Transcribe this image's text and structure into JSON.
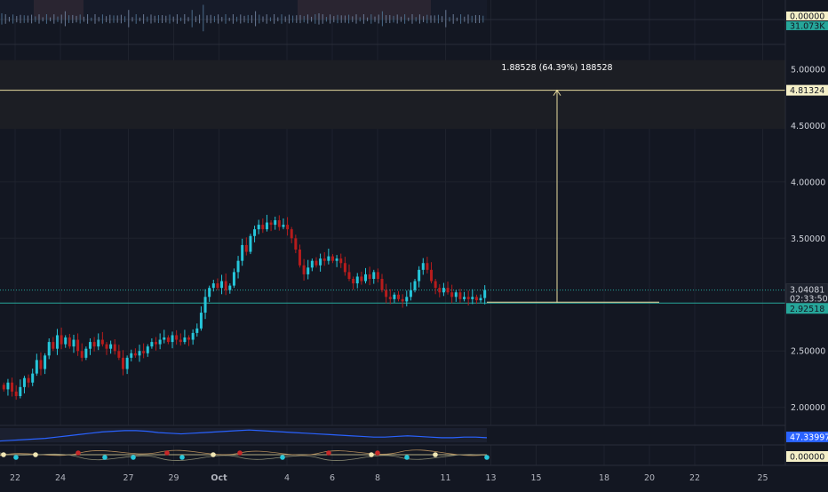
{
  "chart_data": {
    "type": "candlestick",
    "title": "",
    "colors": {
      "background": "#131722",
      "up": "#26c6da",
      "down": "#b71c1c",
      "grid": "#1e222d",
      "measure_zone": "#1c1e24",
      "measure_line": "#e8dca0",
      "price_line": "#26a69a",
      "oscillator_line": "#2962ff",
      "axis_text": "#d1d4dc"
    },
    "price_axis": {
      "ylim": [
        1.84,
        5.22
      ],
      "ticks": [
        {
          "value": 5.0,
          "label": "5.00000"
        },
        {
          "value": 4.5,
          "label": "4.50000"
        },
        {
          "value": 4.0,
          "label": "4.00000"
        },
        {
          "value": 3.5,
          "label": "3.50000"
        },
        {
          "value": 2.5,
          "label": "2.50000"
        },
        {
          "value": 2.0,
          "label": "2.00000"
        }
      ]
    },
    "time_axis": {
      "ticks": [
        {
          "pos": 4,
          "label": "22"
        },
        {
          "pos": 16,
          "label": "24"
        },
        {
          "pos": 34,
          "label": "27"
        },
        {
          "pos": 46,
          "label": "29"
        },
        {
          "pos": 58,
          "label": "Oct"
        },
        {
          "pos": 76,
          "label": "4"
        },
        {
          "pos": 88,
          "label": "6"
        },
        {
          "pos": 100,
          "label": "8"
        },
        {
          "pos": 118,
          "label": "11"
        },
        {
          "pos": 130,
          "label": "13"
        },
        {
          "pos": 142,
          "label": "15"
        },
        {
          "pos": 160,
          "label": "18"
        },
        {
          "pos": 172,
          "label": "20"
        },
        {
          "pos": 184,
          "label": "22"
        },
        {
          "pos": 202,
          "label": "25"
        }
      ],
      "xlim": [
        0,
        208
      ]
    },
    "candles": [
      [
        2.2,
        2.16
      ],
      [
        2.16,
        2.22
      ],
      [
        2.22,
        2.14
      ],
      [
        2.14,
        2.1
      ],
      [
        2.1,
        2.18
      ],
      [
        2.18,
        2.26
      ],
      [
        2.26,
        2.22
      ],
      [
        2.22,
        2.3
      ],
      [
        2.3,
        2.42
      ],
      [
        2.42,
        2.34
      ],
      [
        2.34,
        2.46
      ],
      [
        2.46,
        2.58
      ],
      [
        2.58,
        2.52
      ],
      [
        2.52,
        2.64
      ],
      [
        2.64,
        2.56
      ],
      [
        2.56,
        2.62
      ],
      [
        2.62,
        2.54
      ],
      [
        2.54,
        2.6
      ],
      [
        2.6,
        2.5
      ],
      [
        2.5,
        2.44
      ],
      [
        2.44,
        2.52
      ],
      [
        2.52,
        2.58
      ],
      [
        2.58,
        2.54
      ],
      [
        2.54,
        2.6
      ],
      [
        2.6,
        2.56
      ],
      [
        2.56,
        2.52
      ],
      [
        2.52,
        2.56
      ],
      [
        2.56,
        2.5
      ],
      [
        2.5,
        2.44
      ],
      [
        2.44,
        2.34
      ],
      [
        2.34,
        2.44
      ],
      [
        2.44,
        2.48
      ],
      [
        2.48,
        2.46
      ],
      [
        2.46,
        2.5
      ],
      [
        2.5,
        2.48
      ],
      [
        2.48,
        2.54
      ],
      [
        2.54,
        2.58
      ],
      [
        2.58,
        2.56
      ],
      [
        2.56,
        2.6
      ],
      [
        2.6,
        2.62
      ],
      [
        2.62,
        2.58
      ],
      [
        2.58,
        2.64
      ],
      [
        2.64,
        2.6
      ],
      [
        2.6,
        2.58
      ],
      [
        2.58,
        2.62
      ],
      [
        2.62,
        2.6
      ],
      [
        2.6,
        2.66
      ],
      [
        2.66,
        2.7
      ],
      [
        2.7,
        2.84
      ],
      [
        2.84,
        2.98
      ],
      [
        2.98,
        3.06
      ],
      [
        3.06,
        3.1
      ],
      [
        3.1,
        3.06
      ],
      [
        3.06,
        3.12
      ],
      [
        3.12,
        3.04
      ],
      [
        3.04,
        3.08
      ],
      [
        3.08,
        3.2
      ],
      [
        3.2,
        3.3
      ],
      [
        3.3,
        3.44
      ],
      [
        3.44,
        3.38
      ],
      [
        3.38,
        3.52
      ],
      [
        3.52,
        3.58
      ],
      [
        3.58,
        3.62
      ],
      [
        3.62,
        3.58
      ],
      [
        3.58,
        3.64
      ],
      [
        3.64,
        3.62
      ],
      [
        3.62,
        3.66
      ],
      [
        3.66,
        3.6
      ],
      [
        3.6,
        3.62
      ],
      [
        3.62,
        3.58
      ],
      [
        3.58,
        3.5
      ],
      [
        3.5,
        3.4
      ],
      [
        3.4,
        3.26
      ],
      [
        3.26,
        3.18
      ],
      [
        3.18,
        3.24
      ],
      [
        3.24,
        3.3
      ],
      [
        3.3,
        3.26
      ],
      [
        3.26,
        3.32
      ],
      [
        3.32,
        3.3
      ],
      [
        3.3,
        3.34
      ],
      [
        3.34,
        3.3
      ],
      [
        3.3,
        3.32
      ],
      [
        3.32,
        3.28
      ],
      [
        3.28,
        3.2
      ],
      [
        3.2,
        3.14
      ],
      [
        3.14,
        3.1
      ],
      [
        3.1,
        3.16
      ],
      [
        3.16,
        3.12
      ],
      [
        3.12,
        3.18
      ],
      [
        3.18,
        3.14
      ],
      [
        3.14,
        3.2
      ],
      [
        3.2,
        3.14
      ],
      [
        3.14,
        3.04
      ],
      [
        3.04,
        2.98
      ],
      [
        2.98,
        2.96
      ],
      [
        2.96,
        3.0
      ],
      [
        3.0,
        2.96
      ],
      [
        2.96,
        2.94
      ],
      [
        2.94,
        2.98
      ],
      [
        2.98,
        3.04
      ],
      [
        3.04,
        3.12
      ],
      [
        3.12,
        3.22
      ],
      [
        3.22,
        3.28
      ],
      [
        3.28,
        3.22
      ],
      [
        3.22,
        3.12
      ],
      [
        3.12,
        3.06
      ],
      [
        3.06,
        3.02
      ],
      [
        3.02,
        3.06
      ],
      [
        3.06,
        3.02
      ],
      [
        3.02,
        2.98
      ],
      [
        2.98,
        3.02
      ],
      [
        3.02,
        2.96
      ],
      [
        2.96,
        2.98
      ],
      [
        2.98,
        2.96
      ],
      [
        2.96,
        2.98
      ],
      [
        2.98,
        2.95
      ],
      [
        2.95,
        2.97
      ],
      [
        2.97,
        3.04
      ]
    ],
    "last_price": {
      "value": 3.04081,
      "label": "3.04081",
      "countdown": "02:33:50"
    },
    "support_line": {
      "value": 2.92518,
      "label": "2.92518"
    },
    "measure": {
      "from": 2.92518,
      "to": 4.81324,
      "zone_top": 5.08,
      "zone_bottom": 4.47,
      "label": "1.88528 (64.39%) 188528",
      "target_label": "4.81324"
    },
    "indicators": {
      "volume_value_label": "31.073K",
      "top_value_label": "0.00000",
      "oscillator_value_label": "47.33997",
      "oscillator_values": [
        42,
        43,
        44,
        45,
        46,
        48,
        50,
        52,
        54,
        56,
        57,
        58,
        58,
        57,
        55,
        54,
        53,
        54,
        55,
        56,
        57,
        58,
        59,
        58,
        57,
        56,
        55,
        54,
        53,
        52,
        51,
        50,
        49,
        48,
        48,
        49,
        50,
        49,
        48,
        47,
        47,
        48,
        48,
        47
      ],
      "dots_value_label": "0.00000"
    }
  }
}
